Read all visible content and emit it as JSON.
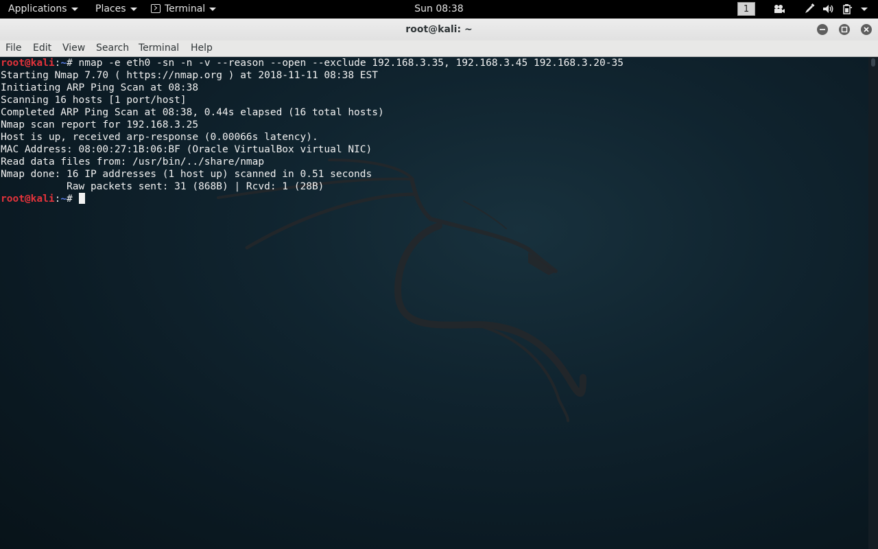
{
  "panel": {
    "applications": "Applications",
    "places": "Places",
    "terminal": "Terminal",
    "clock": "Sun 08:38",
    "workspace": "1",
    "icons": [
      "video-camera-icon",
      "pen-tool-icon",
      "volume-icon",
      "battery-icon",
      "system-menu-chevron-icon"
    ]
  },
  "window": {
    "title": "root@kali: ~"
  },
  "menu": {
    "file": "File",
    "edit": "Edit",
    "view": "View",
    "search": "Search",
    "terminal": "Terminal",
    "help": "Help"
  },
  "terminal": {
    "prompt_user": "root@kali",
    "prompt_colon": ":",
    "prompt_path": "~",
    "prompt_symbol": "# ",
    "command": "nmap -e eth0 -sn -n -v --reason --open --exclude 192.168.3.35, 192.168.3.45 192.168.3.20-35",
    "output": [
      "Starting Nmap 7.70 ( https://nmap.org ) at 2018-11-11 08:38 EST",
      "Initiating ARP Ping Scan at 08:38",
      "Scanning 16 hosts [1 port/host]",
      "Completed ARP Ping Scan at 08:38, 0.44s elapsed (16 total hosts)",
      "Nmap scan report for 192.168.3.25",
      "Host is up, received arp-response (0.00066s latency).",
      "MAC Address: 08:00:27:1B:06:BF (Oracle VirtualBox virtual NIC)",
      "Read data files from: /usr/bin/../share/nmap",
      "Nmap done: 16 IP addresses (1 host up) scanned in 0.51 seconds",
      "           Raw packets sent: 31 (868B) | Rcvd: 1 (28B)"
    ]
  },
  "colors": {
    "prompt_user": "#e4333b",
    "prompt_path": "#5a7de6",
    "panel_bg": "#000000",
    "terminal_text": "#f2f2f2"
  }
}
